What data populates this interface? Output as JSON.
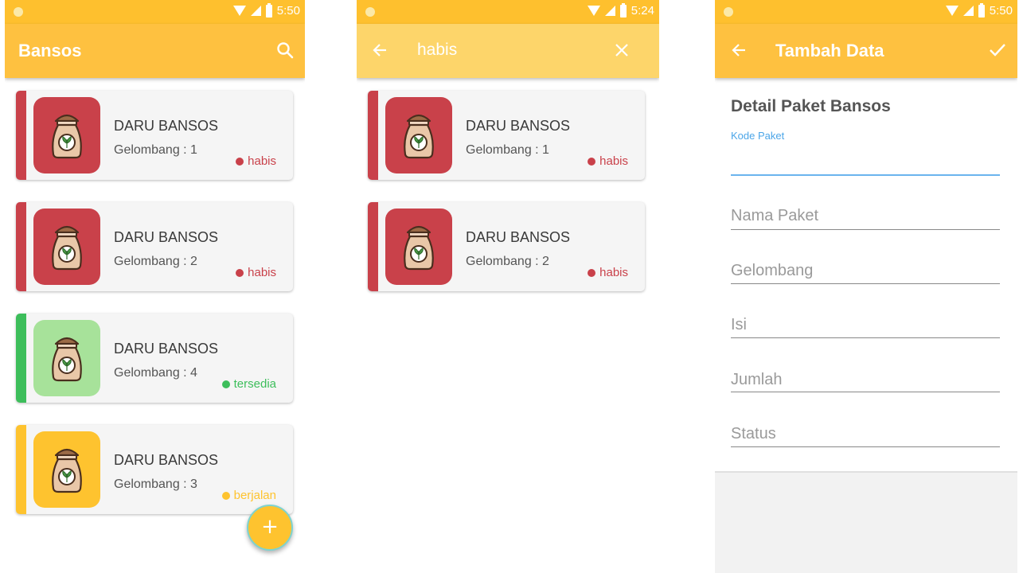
{
  "screen1": {
    "statusbar": {
      "time": "5:50"
    },
    "appbar": {
      "title": "Bansos",
      "search_icon": "search-icon"
    },
    "cards": [
      {
        "name": "DARU BANSOS",
        "wave": "Gelombang : 1",
        "status": "habis",
        "color": "#C9414A",
        "thumb_color": "#C9414A"
      },
      {
        "name": "DARU BANSOS",
        "wave": "Gelombang : 2",
        "status": "habis",
        "color": "#C9414A",
        "thumb_color": "#C9414A"
      },
      {
        "name": "DARU BANSOS",
        "wave": "Gelombang : 4",
        "status": "tersedia",
        "color": "#3DBE5B",
        "thumb_color": "#A7E29A"
      },
      {
        "name": "DARU BANSOS",
        "wave": "Gelombang : 3",
        "status": "berjalan",
        "color": "#FEC32F",
        "thumb_color": "#FEC32F"
      }
    ],
    "fab": {
      "label": "+"
    }
  },
  "screen2": {
    "statusbar": {
      "time": "5:24"
    },
    "appbar": {
      "search_query": "habis",
      "back_icon": "arrow-left-icon",
      "close_icon": "close-icon"
    },
    "cards": [
      {
        "name": "DARU BANSOS",
        "wave": "Gelombang : 1",
        "status": "habis",
        "color": "#C9414A",
        "thumb_color": "#C9414A"
      },
      {
        "name": "DARU BANSOS",
        "wave": "Gelombang : 2",
        "status": "habis",
        "color": "#C9414A",
        "thumb_color": "#C9414A"
      }
    ]
  },
  "screen3": {
    "statusbar": {
      "time": "5:50"
    },
    "appbar": {
      "title": "Tambah Data",
      "back_icon": "arrow-left-icon",
      "check_icon": "check-icon"
    },
    "form": {
      "title": "Detail Paket Bansos",
      "kode_label": "Kode Paket",
      "fields": [
        {
          "placeholder": "Nama Paket"
        },
        {
          "placeholder": "Gelombang"
        },
        {
          "placeholder": "Isi"
        },
        {
          "placeholder": "Jumlah"
        },
        {
          "placeholder": "Status"
        }
      ]
    }
  },
  "colors": {
    "accent": "#FEC140",
    "statusbar": "#FEC02E",
    "focus": "#4CA6E8"
  }
}
